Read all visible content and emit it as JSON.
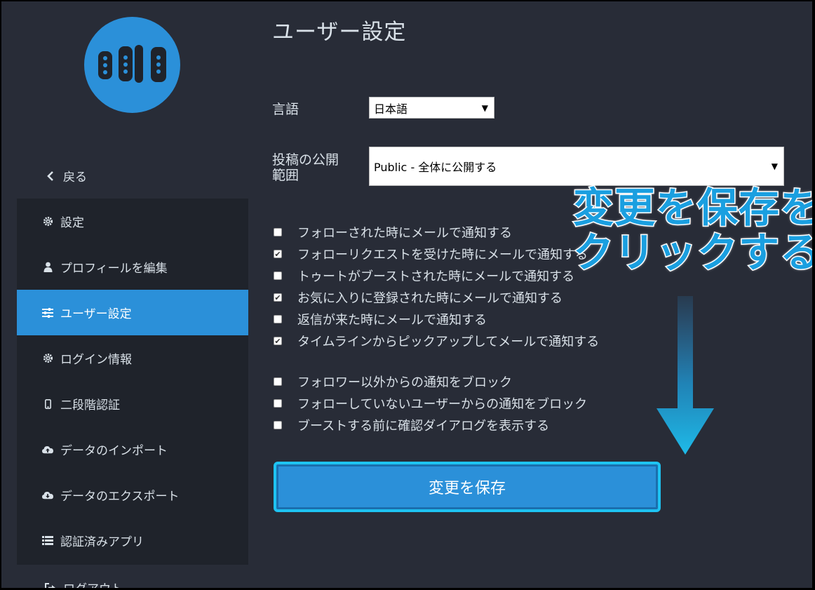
{
  "colors": {
    "background": "#282c37",
    "sidebar_group": "#1f232b",
    "accent": "#2b90d9",
    "highlight_border": "#1ec3f2",
    "text": "#d9e1e8"
  },
  "sidebar": {
    "logo_icon": "mastodon-logo-icon",
    "back": {
      "icon": "chevron-left-icon",
      "label": "戻る"
    },
    "items": [
      {
        "icon": "gear-icon",
        "label": "設定",
        "active": false
      },
      {
        "icon": "user-icon",
        "label": "プロフィールを編集",
        "active": false
      },
      {
        "icon": "sliders-icon",
        "label": "ユーザー設定",
        "active": true
      },
      {
        "icon": "gear-icon",
        "label": "ログイン情報",
        "active": false
      },
      {
        "icon": "mobile-icon",
        "label": "二段階認証",
        "active": false
      },
      {
        "icon": "cloud-upload-icon",
        "label": "データのインポート",
        "active": false
      },
      {
        "icon": "cloud-download-icon",
        "label": "データのエクスポート",
        "active": false
      },
      {
        "icon": "list-icon",
        "label": "認証済みアプリ",
        "active": false
      }
    ],
    "logout": {
      "icon": "sign-out-icon",
      "label": "ログアウト"
    }
  },
  "main": {
    "title": "ユーザー設定",
    "language": {
      "label": "言語",
      "value": "日本語"
    },
    "privacy": {
      "label": "投稿の公開範囲",
      "value": "Public - 全体に公開する"
    },
    "email_notifications": [
      {
        "label": "フォローされた時にメールで通知する",
        "checked": false
      },
      {
        "label": "フォローリクエストを受けた時にメールで通知する",
        "checked": true
      },
      {
        "label": "トゥートがブーストされた時にメールで通知する",
        "checked": false
      },
      {
        "label": "お気に入りに登録された時にメールで通知する",
        "checked": true
      },
      {
        "label": "返信が来た時にメールで通知する",
        "checked": false
      },
      {
        "label": "タイムラインからピックアップしてメールで通知する",
        "checked": true
      }
    ],
    "other_options": [
      {
        "label": "フォロワー以外からの通知をブロック",
        "checked": false
      },
      {
        "label": "フォローしていないユーザーからの通知をブロック",
        "checked": false
      },
      {
        "label": "ブーストする前に確認ダイアログを表示する",
        "checked": false
      }
    ],
    "save_label": "変更を保存"
  },
  "annotation": {
    "line1": "変更を保存を",
    "line2": "クリックする",
    "arrow_icon": "arrow-down-icon"
  }
}
